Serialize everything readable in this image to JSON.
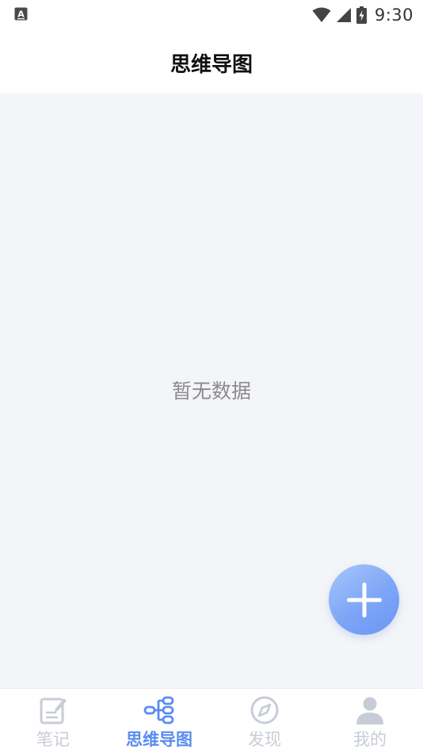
{
  "status_bar": {
    "time": "9:30",
    "left_icon": "keyboard-a-icon",
    "icons": [
      "wifi-icon",
      "signal-icon",
      "battery-charging-icon"
    ]
  },
  "header": {
    "title": "思维导图"
  },
  "main": {
    "empty_message": "暂无数据",
    "fab_icon": "plus-icon"
  },
  "bottom_nav": {
    "active_index": 1,
    "items": [
      {
        "label": "笔记",
        "icon": "note-edit-icon"
      },
      {
        "label": "思维导图",
        "icon": "mind-map-icon"
      },
      {
        "label": "发现",
        "icon": "compass-icon"
      },
      {
        "label": "我的",
        "icon": "person-icon"
      }
    ]
  },
  "colors": {
    "accent": "#5b8cf0",
    "inactive": "#c7ccd6",
    "content_bg": "#f4f5f8",
    "fab_gradient_start": "#a9c6fb",
    "fab_gradient_end": "#6d95f2"
  }
}
